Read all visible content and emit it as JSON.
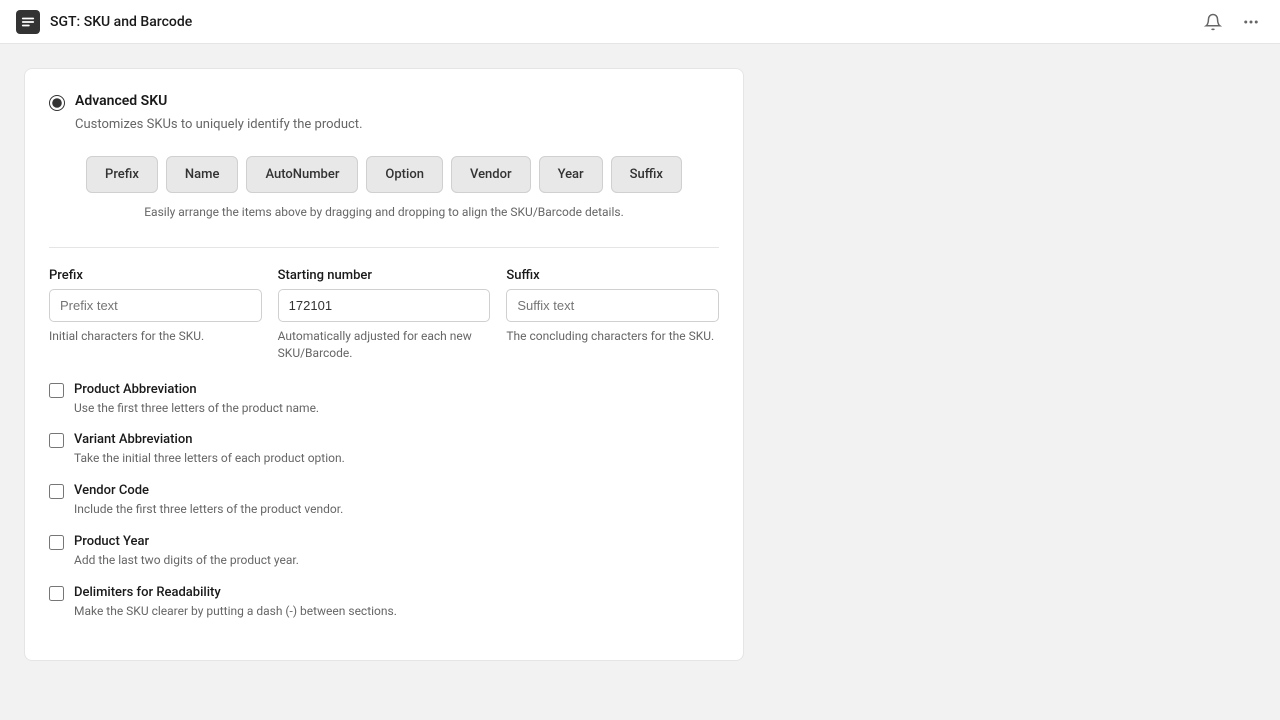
{
  "header": {
    "title": "SGT: SKU and Barcode",
    "app_icon_label": "app-icon"
  },
  "section": {
    "radio_label": "Advanced SKU",
    "radio_subtitle": "Customizes SKUs to uniquely identify the product.",
    "drag_items": [
      {
        "label": "Prefix",
        "id": "prefix"
      },
      {
        "label": "Name",
        "id": "name"
      },
      {
        "label": "AutoNumber",
        "id": "autonumber"
      },
      {
        "label": "Option",
        "id": "option"
      },
      {
        "label": "Vendor",
        "id": "vendor"
      },
      {
        "label": "Year",
        "id": "year"
      },
      {
        "label": "Suffix",
        "id": "suffix"
      }
    ],
    "drag_hint": "Easily arrange the items above by dragging and dropping to align the SKU/Barcode details.",
    "fields": [
      {
        "label": "Prefix",
        "placeholder": "Prefix text",
        "value": "",
        "hint": "Initial characters for the SKU."
      },
      {
        "label": "Starting number",
        "placeholder": "",
        "value": "172101",
        "hint": "Automatically adjusted for each new SKU/Barcode."
      },
      {
        "label": "Suffix",
        "placeholder": "Suffix text",
        "value": "",
        "hint": "The concluding characters for the SKU."
      }
    ],
    "checkboxes": [
      {
        "label": "Product Abbreviation",
        "description": "Use the first three letters of the product name."
      },
      {
        "label": "Variant Abbreviation",
        "description": "Take the initial three letters of each product option."
      },
      {
        "label": "Vendor Code",
        "description": "Include the first three letters of the product vendor."
      },
      {
        "label": "Product Year",
        "description": "Add the last two digits of the product year."
      },
      {
        "label": "Delimiters for Readability",
        "description": "Make the SKU clearer by putting a dash (-) between sections."
      }
    ]
  }
}
